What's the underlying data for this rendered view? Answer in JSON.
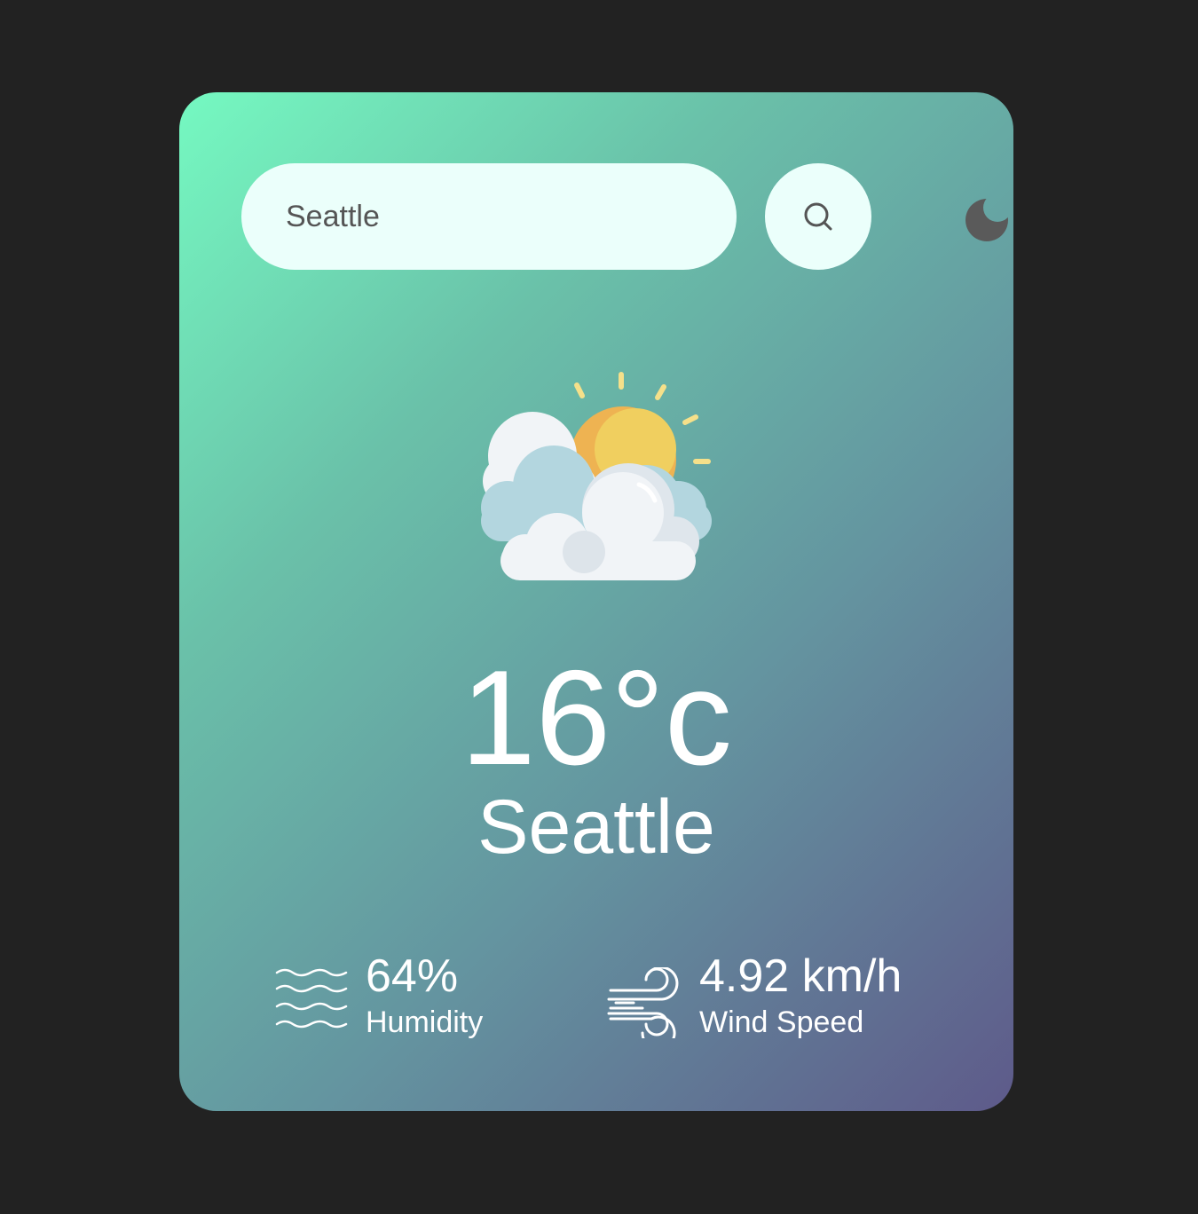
{
  "search": {
    "value": "Seattle"
  },
  "icons": {
    "search": "search-icon",
    "theme": "moon-icon",
    "weather": "partly-cloudy-icon",
    "humidity": "humidity-waves-icon",
    "wind": "wind-icon"
  },
  "weather": {
    "temperature": "16°c",
    "city": "Seattle"
  },
  "details": {
    "humidity": {
      "value": "64%",
      "label": "Humidity"
    },
    "wind": {
      "value": "4.92 km/h",
      "label": "Wind Speed"
    }
  },
  "colors": {
    "background": "#222222",
    "gradient_start": "#75f9c1",
    "gradient_end": "#5e5a8a",
    "input_background": "#ebfffb",
    "text": "#ffffff"
  }
}
